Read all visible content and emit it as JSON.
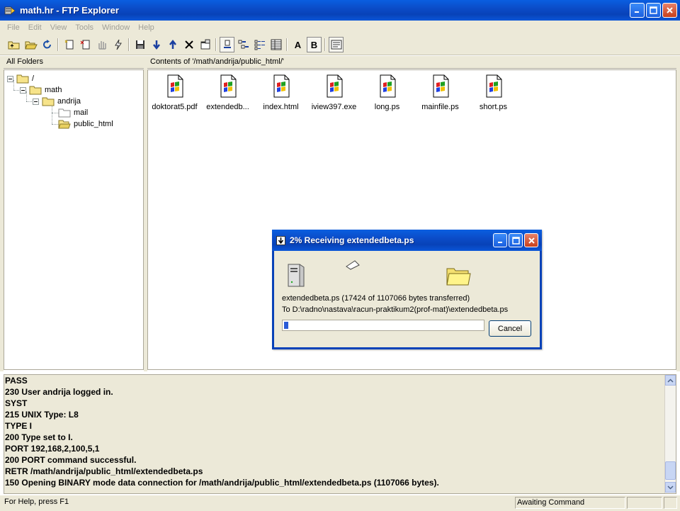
{
  "window": {
    "title": "math.hr - FTP Explorer"
  },
  "menu": [
    "File",
    "Edit",
    "View",
    "Tools",
    "Window",
    "Help"
  ],
  "toolbar": {
    "font_a": "A",
    "font_b": "B"
  },
  "left_header": "All Folders",
  "right_header": "Contents of '/math/andrija/public_html/'",
  "tree": [
    {
      "label": "/"
    },
    {
      "label": "math"
    },
    {
      "label": "andrija"
    },
    {
      "label": "mail"
    },
    {
      "label": "public_html"
    }
  ],
  "files": [
    {
      "name": "doktorat5.pdf"
    },
    {
      "name": "extendedb..."
    },
    {
      "name": "index.html"
    },
    {
      "name": "iview397.exe"
    },
    {
      "name": "long.ps"
    },
    {
      "name": "mainfile.ps"
    },
    {
      "name": "short.ps"
    }
  ],
  "dialog": {
    "title": "2% Receiving extendedbeta.ps",
    "line1": "extendedbeta.ps (17424 of 1107066 bytes transferred)",
    "line2": "To D:\\radno\\nastava\\racun-praktikum2(prof-mat)\\extendedbeta.ps",
    "progress_percent": 2,
    "cancel_label": "Cancel"
  },
  "log": [
    "PASS",
    "230 User andrija logged in.",
    "SYST",
    "215 UNIX Type: L8",
    "TYPE I",
    "200 Type set to I.",
    "PORT 192,168,2,100,5,1",
    "200 PORT command successful.",
    "RETR /math/andrija/public_html/extendedbeta.ps",
    "150 Opening BINARY mode data connection for /math/andrija/public_html/extendedbeta.ps (1107066 bytes)."
  ],
  "status": {
    "help": "For Help, press F1",
    "state": "Awaiting Command"
  },
  "colors": {
    "titlebar": "#0842b8",
    "face": "#ece9d8",
    "progress": "#2a5bd7"
  }
}
